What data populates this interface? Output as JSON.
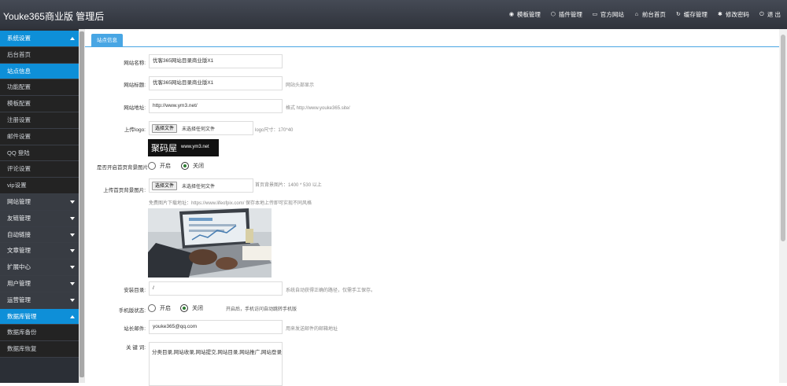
{
  "header": {
    "brand": "Youke365商业版 管理后",
    "nav": [
      {
        "icon": "template-icon",
        "glyph": "◉",
        "label": "模板管理"
      },
      {
        "icon": "plugin-icon",
        "glyph": "⬡",
        "label": "插件管理"
      },
      {
        "icon": "monitor-icon",
        "glyph": "▭",
        "label": "官方网站"
      },
      {
        "icon": "home-icon",
        "glyph": "⌂",
        "label": "前台首页"
      },
      {
        "icon": "refresh-icon",
        "glyph": "↻",
        "label": "缓存管理"
      },
      {
        "icon": "settings-icon",
        "glyph": "✱",
        "label": "修改密码"
      },
      {
        "icon": "power-icon",
        "glyph": "⏻",
        "label": "退 出"
      }
    ]
  },
  "sidebar": {
    "sections": [
      {
        "label": "系统设置",
        "open": true,
        "children": [
          "后台首页",
          "站点信息",
          "功能配置",
          "模板配置",
          "注册设置",
          "邮件设置",
          "QQ 登陆",
          "评论设置",
          "vip设置"
        ],
        "active": 1
      },
      {
        "label": "网站管理",
        "open": false
      },
      {
        "label": "友链管理",
        "open": false
      },
      {
        "label": "自动链接",
        "open": false
      },
      {
        "label": "文章管理",
        "open": false
      },
      {
        "label": "扩展中心",
        "open": false
      },
      {
        "label": "用户管理",
        "open": false
      },
      {
        "label": "运营管理",
        "open": false
      },
      {
        "label": "数据库管理",
        "open": true,
        "children": [
          "数据库备份",
          "数据库恢复"
        ],
        "active": -1
      }
    ]
  },
  "main": {
    "tab": "站点信息",
    "form": {
      "site_name": {
        "label": "网站名称:",
        "value": "优客365网站目录商业版X1"
      },
      "site_title": {
        "label": "网站标题:",
        "value": "优客365网站目录商业版X1",
        "hint": "网站头部显示"
      },
      "site_url": {
        "label": "网站地址:",
        "value": "http://www.ym3.net/",
        "hint": "格式 http://www.youke365.site/"
      },
      "logo": {
        "label": "上传logo:",
        "button": "选择文件",
        "file_text": "未选择任何文件",
        "hint": "logo尺寸：170*40",
        "logo_main": "聚码屋",
        "logo_url": "www.ym3.net"
      },
      "home_bg": {
        "label": "是否开启首页背景图片",
        "options": [
          "开启",
          "关闭"
        ],
        "selected": 1
      },
      "home_bg_upload": {
        "label": "上传首页背景图片:",
        "button": "选择文件",
        "file_text": "未选择任何文件",
        "hint": "首页背景图片：1400 * 530 以上",
        "note": "免费图片下载地址：https://www.lifeofpix.com/ 保存本地上传即可实现不同风格"
      },
      "install_dir": {
        "label": "安装目录:",
        "value": "/",
        "hint": "系统自动获得正确的路径，仅需手工保存。"
      },
      "mobile_status": {
        "label": "手机版状态:",
        "options": [
          "开启",
          "关闭"
        ],
        "selected": 1,
        "hint": "开启后，手机访问自动跳转手机版"
      },
      "admin_email": {
        "label": "站长邮件:",
        "value": "youke365@qq.com",
        "hint": "用来发送邮件的邮箱地址"
      },
      "keywords": {
        "label": "关 键 词:",
        "value": "分类目录,网站收录,网站提交,网站目录,网站推广,网站登录"
      }
    }
  },
  "colors": {
    "accent": "#0e8fd8",
    "topbar": "#3a3e47",
    "sidebar": "#2b2f36",
    "radio_on": "#2e7d32"
  }
}
